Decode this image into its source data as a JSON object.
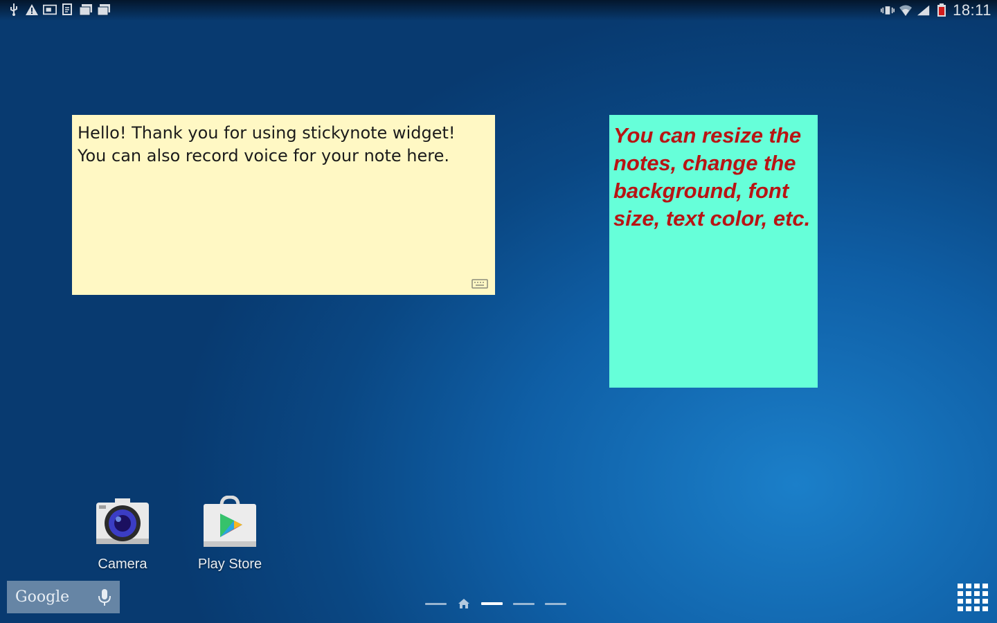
{
  "status_bar": {
    "left_icons": [
      "usb-icon",
      "warning-icon",
      "screenshot-icon",
      "document-icon",
      "gallery-icon",
      "gallery-icon"
    ],
    "right_icons": [
      "vibrate-icon",
      "wifi-icon",
      "signal-icon",
      "battery-icon"
    ],
    "time": "18:11"
  },
  "widgets": {
    "note_yellow": {
      "text": "Hello! Thank you for using stickynote widget!\nYou can also record voice for your note here.",
      "background": "#fff8c4",
      "text_color": "#1b1b1b",
      "icon": "keyboard-icon"
    },
    "note_cyan": {
      "text": "You can resize the notes, change the background, font size, text color, etc.",
      "background": "#66ffd9",
      "text_color": "#b81414"
    }
  },
  "dock": {
    "apps": [
      {
        "label": "Camera",
        "icon": "camera-icon"
      },
      {
        "label": "Play Store",
        "icon": "play-store-icon"
      }
    ]
  },
  "search": {
    "logo": "Google",
    "icon": "mic-icon"
  },
  "page_indicator": {
    "count": 5,
    "home_index": 1,
    "current_index": 2
  },
  "apps_button": {
    "icon": "app-drawer-icon"
  }
}
